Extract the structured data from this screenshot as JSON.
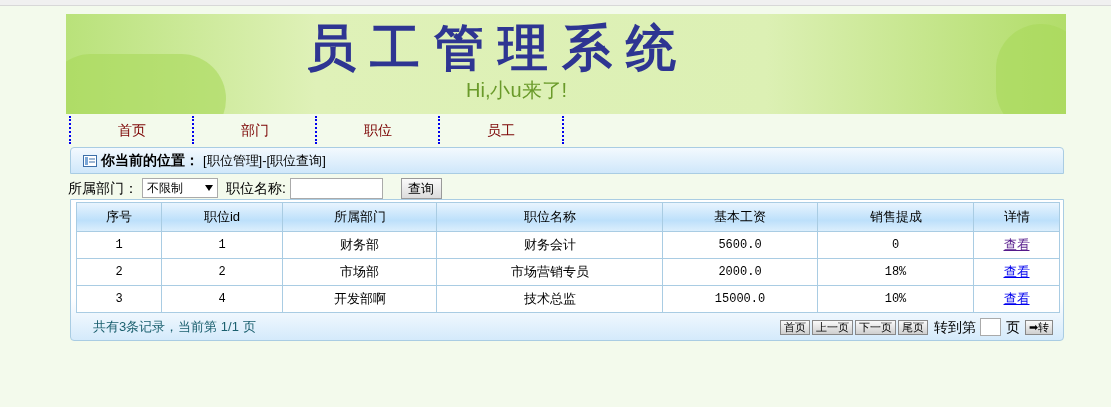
{
  "banner": {
    "title": "员工管理系统",
    "subtitle": "Hi,小u来了!"
  },
  "nav": [
    {
      "label": "首页"
    },
    {
      "label": "部门"
    },
    {
      "label": "职位"
    },
    {
      "label": "员工"
    }
  ],
  "breadcrumb": {
    "label": "你当前的位置：",
    "path": "[职位管理]-[职位查询]"
  },
  "filter": {
    "department_label": "所属部门：",
    "department_value": "不限制",
    "name_label": "职位名称:",
    "search_button": "查询"
  },
  "table": {
    "columns": [
      "序号",
      "职位id",
      "所属部门",
      "职位名称",
      "基本工资",
      "销售提成",
      "详情"
    ],
    "rows": [
      {
        "cells": [
          "1",
          "1",
          "财务部",
          "财务会计",
          "5600.0",
          "0"
        ],
        "link": "查看",
        "visited": true
      },
      {
        "cells": [
          "2",
          "2",
          "市场部",
          "市场营销专员",
          "2000.0",
          "18%"
        ],
        "link": "查看",
        "visited": false
      },
      {
        "cells": [
          "3",
          "4",
          "开发部啊",
          "技术总监",
          "15000.0",
          "10%"
        ],
        "link": "查看",
        "visited": false
      }
    ]
  },
  "pager": {
    "summary": "共有3条记录，当前第 1/1 页",
    "buttons": [
      "首页",
      "上一页",
      "下一页",
      "尾页"
    ],
    "goto_label": "转到第",
    "page_label": "页",
    "go_button": "➡转"
  }
}
